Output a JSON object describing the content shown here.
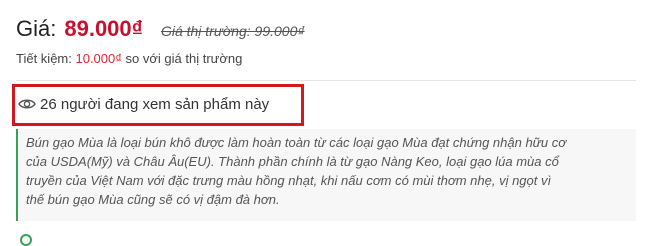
{
  "price": {
    "label": "Giá:",
    "current": "89.000₫",
    "market": "Giá thị trường: 99.000₫"
  },
  "savings": {
    "prefix": "Tiết kiệm:",
    "amount": "10.000₫",
    "suffix": "so với giá thị trường"
  },
  "viewers": {
    "icon": "eye-icon",
    "text": "26 người đang xem sản phẩm này"
  },
  "description": {
    "lines": [
      "Bún gạo Mùa là loại bún khô được làm hoàn toàn từ các loại gạo Mùa đạt chứng nhận hữu cơ",
      "của USDA(Mỹ) và Châu Âu(EU). Thành phần chính là từ gạo Nàng Keo, loại gạo lúa mùa cổ",
      "truyền của Việt Nam với đặc trưng màu hồng nhạt, khi nấu cơm có mùi thơm nhẹ, vị ngọt vì",
      "thế bún gạo Mùa cũng sẽ có vị đậm đà hơn."
    ]
  },
  "colors": {
    "price": "#c8102e",
    "savings_amount": "#e8262e",
    "highlight_border": "#d2171e",
    "description_accent": "#37a05a"
  }
}
